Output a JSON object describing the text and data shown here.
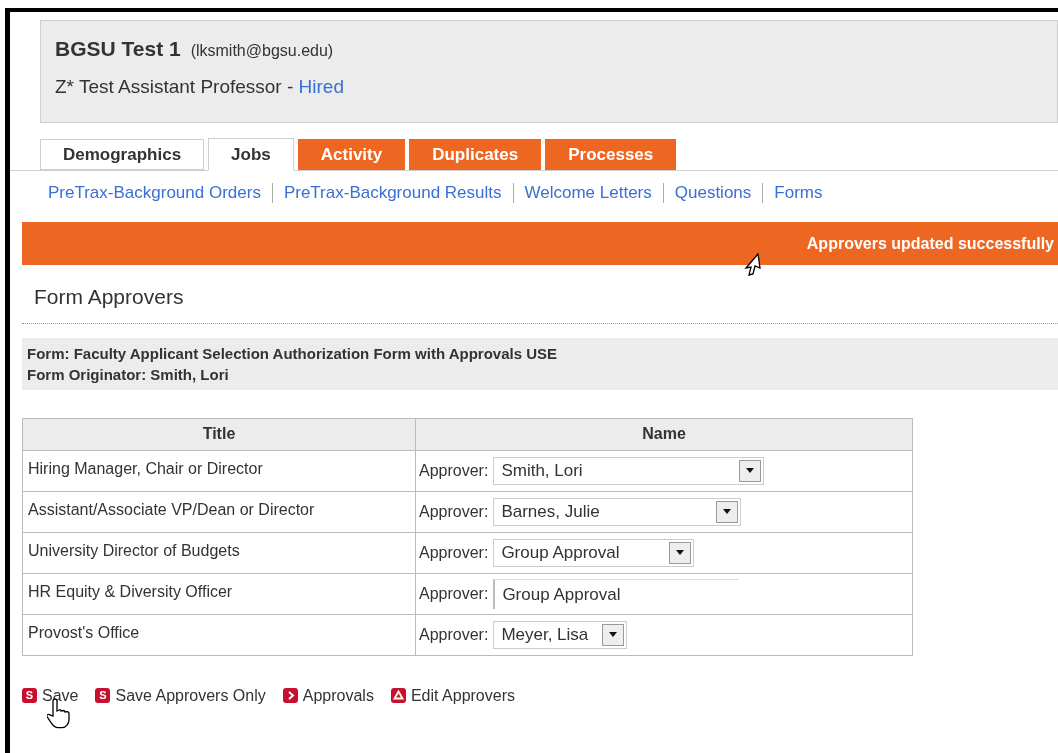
{
  "header": {
    "name": "BGSU Test 1",
    "email": "(lksmith@bgsu.edu)",
    "job": "Z* Test Assistant Professor - ",
    "status": "Hired"
  },
  "tabs": [
    {
      "label": "Demographics",
      "selected": false,
      "highlighted": false
    },
    {
      "label": "Jobs",
      "selected": true,
      "highlighted": false
    },
    {
      "label": "Activity",
      "selected": false,
      "highlighted": true
    },
    {
      "label": "Duplicates",
      "selected": false,
      "highlighted": true
    },
    {
      "label": "Processes",
      "selected": false,
      "highlighted": true
    }
  ],
  "sub_links": [
    "PreTrax-Background Orders",
    "PreTrax-Background Results",
    "Welcome Letters",
    "Questions",
    "Forms"
  ],
  "banner": "Approvers updated successfully",
  "section_title": "Form Approvers",
  "form_info": [
    "Form: Faculty Applicant Selection Authorization Form with Approvals USE",
    "Form Originator: Smith, Lori"
  ],
  "table": {
    "columns": [
      "Title",
      "Name"
    ],
    "rows": [
      {
        "title": "Hiring Manager, Chair or Director",
        "label": "Approver:",
        "value": "Smith, Lori",
        "kind": "select"
      },
      {
        "title": "Assistant/Associate VP/Dean or Director",
        "label": "Approver:",
        "value": "Barnes, Julie",
        "kind": "select"
      },
      {
        "title": "University Director of Budgets",
        "label": "Approver:",
        "value": "Group Approval",
        "kind": "select"
      },
      {
        "title": "HR Equity & Diversity Officer",
        "label": "Approver:",
        "value": "Group Approval",
        "kind": "combo"
      },
      {
        "title": "Provost's Office",
        "label": "Approver:",
        "value": "Meyer, Lisa",
        "kind": "select"
      }
    ]
  },
  "actions": [
    {
      "label": "Save",
      "kind": "letter",
      "icon_text": "S"
    },
    {
      "label": "Save Approvers Only",
      "kind": "letter",
      "icon_text": "S"
    },
    {
      "label": "Approvals",
      "kind": "chevron"
    },
    {
      "label": "Edit Approvers",
      "kind": "triangle"
    }
  ]
}
